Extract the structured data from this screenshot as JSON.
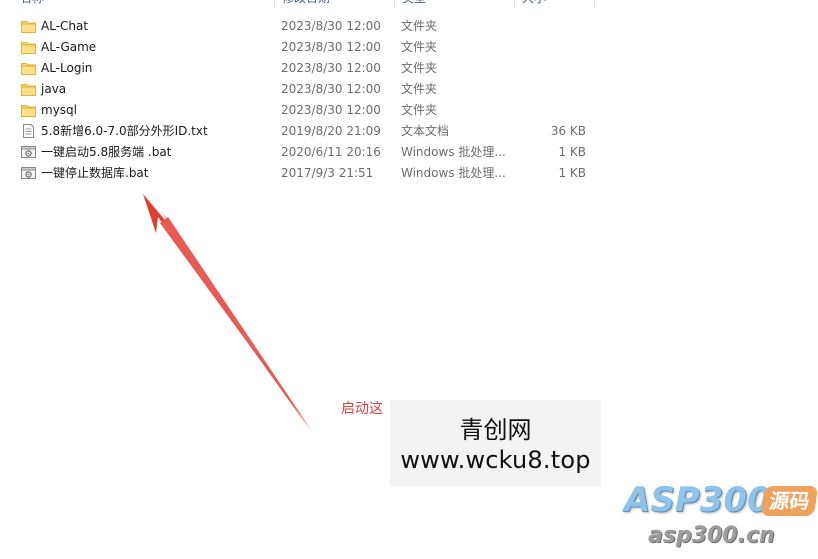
{
  "header": {
    "name_label": "名称",
    "date_label": "修改日期",
    "type_label": "类型",
    "size_label": "大小"
  },
  "files": [
    {
      "name": "AL-Chat",
      "date": "2023/8/30 12:00",
      "type": "文件夹",
      "size": "",
      "icon": "folder-icon"
    },
    {
      "name": "AL-Game",
      "date": "2023/8/30 12:00",
      "type": "文件夹",
      "size": "",
      "icon": "folder-icon"
    },
    {
      "name": "AL-Login",
      "date": "2023/8/30 12:00",
      "type": "文件夹",
      "size": "",
      "icon": "folder-icon"
    },
    {
      "name": "java",
      "date": "2023/8/30 12:00",
      "type": "文件夹",
      "size": "",
      "icon": "folder-icon"
    },
    {
      "name": "mysql",
      "date": "2023/8/30 12:00",
      "type": "文件夹",
      "size": "",
      "icon": "folder-icon"
    },
    {
      "name": "5.8新增6.0-7.0部分外形ID.txt",
      "date": "2019/8/20 21:09",
      "type": "文本文档",
      "size": "36 KB",
      "icon": "text-file-icon"
    },
    {
      "name": "一键启动5.8服务端 .bat",
      "date": "2020/6/11 20:16",
      "type": "Windows 批处理...",
      "size": "1 KB",
      "icon": "batch-file-icon"
    },
    {
      "name": "一键停止数据库.bat",
      "date": "2017/9/3 21:51",
      "type": "Windows 批处理...",
      "size": "1 KB",
      "icon": "batch-file-icon"
    }
  ],
  "annotation": {
    "label": "启动这",
    "color": "#d9473f"
  },
  "watermark": {
    "title": "青创网",
    "url": "www.wcku8.top"
  },
  "logo": {
    "main": "ASP300",
    "badge": "源码",
    "sub": "asp300.cn",
    "main_color": "#8fc3ea",
    "badge_color": "#f0a15c"
  }
}
